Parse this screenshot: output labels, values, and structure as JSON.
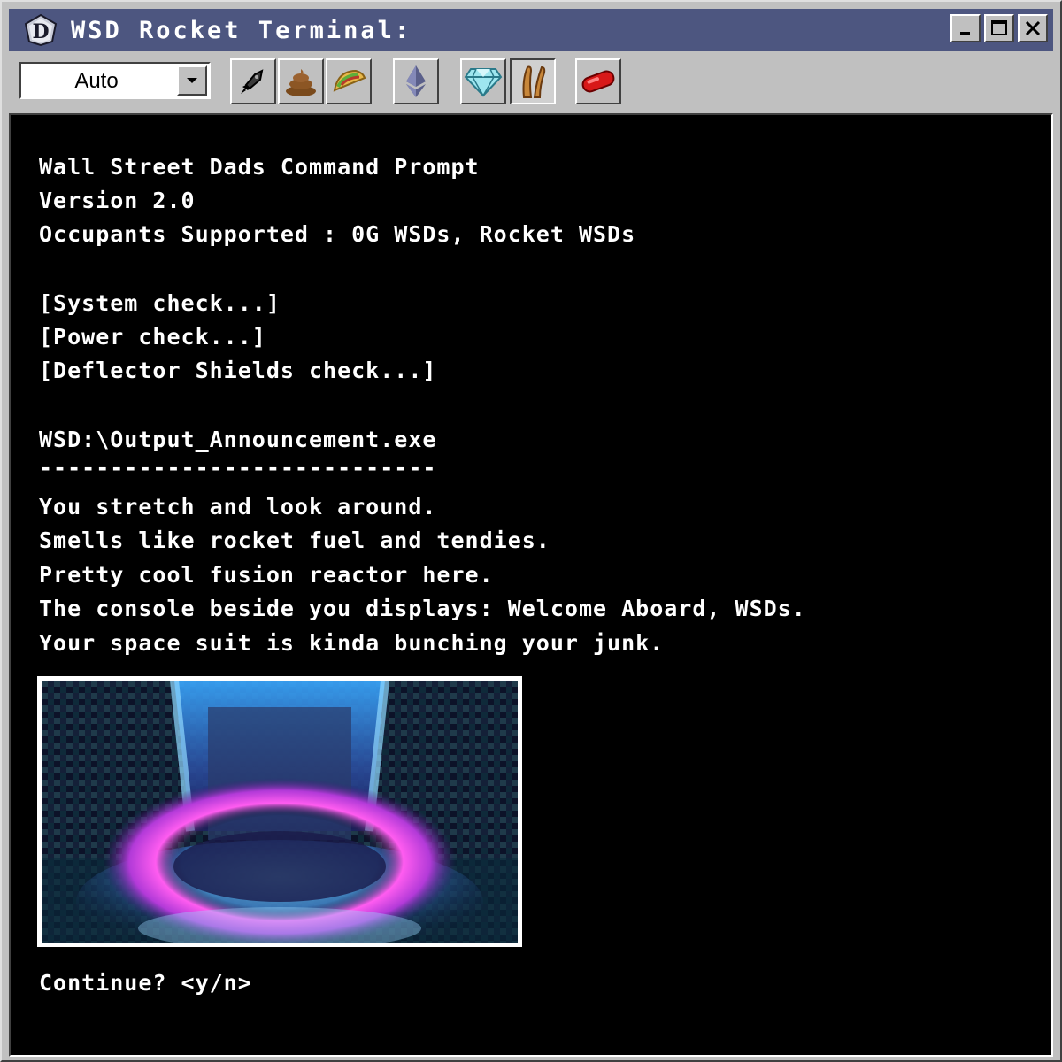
{
  "window": {
    "title": "WSD Rocket Terminal:",
    "minimize_label": "_",
    "maximize_label": "□",
    "close_label": "✕"
  },
  "toolbar": {
    "select_value": "Auto",
    "buttons": [
      {
        "name": "rocket",
        "icon": "rocket-icon"
      },
      {
        "name": "poop",
        "icon": "poop-icon"
      },
      {
        "name": "taco",
        "icon": "taco-icon"
      },
      {
        "name": "ethereum",
        "icon": "ethereum-icon"
      },
      {
        "name": "diamond",
        "icon": "diamond-icon"
      },
      {
        "name": "hands",
        "icon": "hands-icon",
        "pressed": true
      },
      {
        "name": "pill",
        "icon": "red-pill-icon"
      }
    ]
  },
  "terminal": {
    "header_lines": [
      "Wall Street Dads Command Prompt",
      "Version 2.0",
      "Occupants Supported : 0G WSDs, Rocket WSDs"
    ],
    "check_lines": [
      "[System check...]",
      "[Power check...]",
      "[Deflector Shields check...]"
    ],
    "command": "WSD:\\Output_Announcement.exe",
    "separator": "----------------------------",
    "output_lines": [
      "You stretch and look around.",
      "Smells like rocket fuel and tendies.",
      "Pretty cool fusion reactor here.",
      "The console beside you displays: Welcome Aboard, WSDs.",
      "Your space suit is kinda bunching your junk."
    ],
    "prompt": "Continue? <y/n>"
  },
  "colors": {
    "titlebar": "#4d5680",
    "terminal_bg": "#000000",
    "terminal_text": "#ffffff",
    "chrome": "#c0c0c0"
  }
}
